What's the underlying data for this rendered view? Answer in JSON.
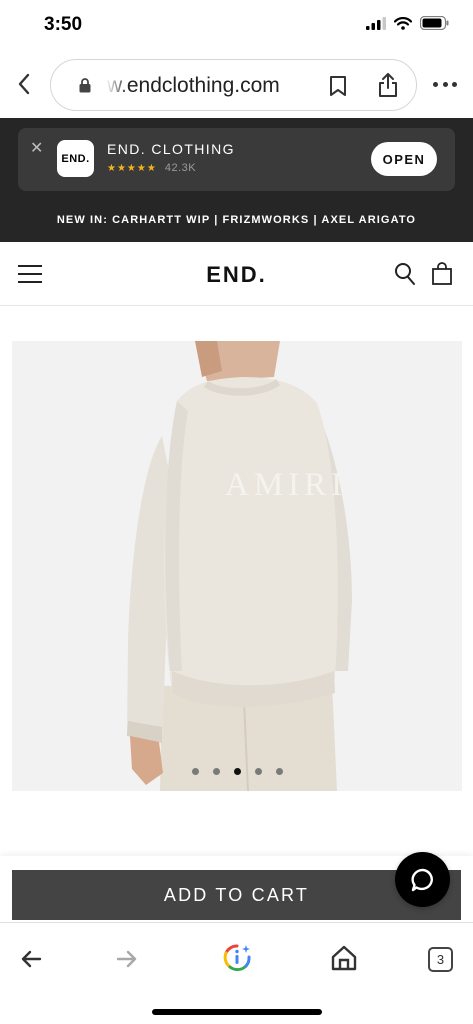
{
  "status_bar": {
    "time": "3:50"
  },
  "browser": {
    "url": "w.endclothing.com",
    "open_tabs": "3"
  },
  "app_banner": {
    "logo_text": "END.",
    "name": "END. CLOTHING",
    "stars": "★★★★★",
    "rating_count": "42.3K",
    "open_label": "OPEN",
    "star_color": "#f3b31b"
  },
  "promo": {
    "text": "NEW IN: CARHARTT WIP | FRIZMWORKS | AXEL ARIGATO"
  },
  "site_header": {
    "logo": "END."
  },
  "product": {
    "garment_print": "AMIRI",
    "gallery": {
      "count": 5,
      "active_index": 3
    }
  },
  "cart": {
    "add_to_cart_label": "ADD TO CART",
    "button_color": "#444444"
  }
}
